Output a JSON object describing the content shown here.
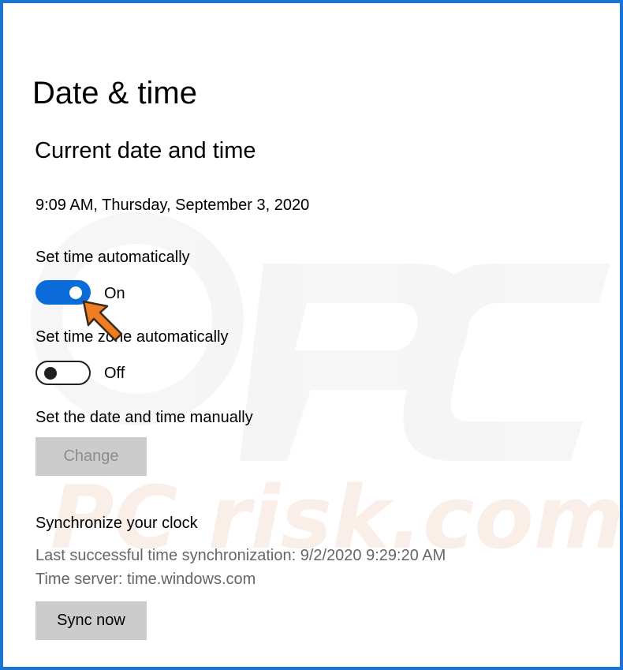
{
  "page": {
    "title": "Date & time",
    "section_title": "Current date and time",
    "current_datetime": "9:09 AM, Thursday, September 3, 2020"
  },
  "set_time_automatically": {
    "label": "Set time automatically",
    "state": "On",
    "enabled": true
  },
  "set_time_zone_automatically": {
    "label": "Set time zone automatically",
    "state": "Off",
    "enabled": false
  },
  "manual": {
    "label": "Set the date and time manually",
    "button": "Change",
    "button_enabled": false
  },
  "sync": {
    "title": "Synchronize your clock",
    "last_sync": "Last successful time synchronization: 9/2/2020 9:29:20 AM",
    "time_server": "Time server: time.windows.com",
    "button": "Sync now"
  },
  "watermark": {
    "text": "PC risk.com"
  },
  "colors": {
    "accent": "#0b6cd9",
    "frame_border": "#1a75d2",
    "pointer": "#f07d22",
    "muted_text": "#666666"
  },
  "icons": {
    "pointer": "orange-arrow-icon"
  }
}
